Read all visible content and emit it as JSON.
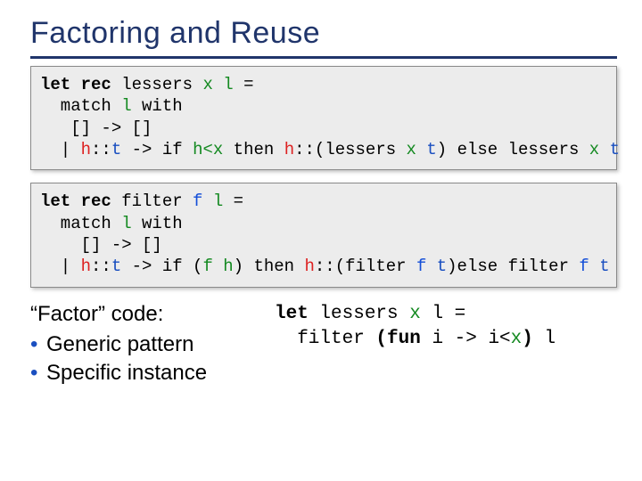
{
  "title": "Factoring and Reuse",
  "code1": {
    "l1_a": "let rec",
    "l1_b": " lessers ",
    "l1_x": "x",
    "l1_sp": " ",
    "l1_l": "l",
    "l1_eq": " =",
    "l2_a": "  match ",
    "l2_l": "l",
    "l2_b": " with",
    "l3": "   [] -> []",
    "l4_a": "  | ",
    "l4_h": "h",
    "l4_sep": "::",
    "l4_t": "t",
    "l4_b": " -> if ",
    "l4_cond": "h<x",
    "l4_c": " then ",
    "l4_h2": "h",
    "l4_sep2": "::",
    "l4_d": "(lessers ",
    "l4_x": "x",
    "l4_sp2": " ",
    "l4_t2": "t",
    "l4_e": ") else lessers ",
    "l4_x2": "x",
    "l4_sp3": " ",
    "l4_t3": "t"
  },
  "code2": {
    "l1_a": "let rec",
    "l1_b": " filter ",
    "l1_f": "f",
    "l1_sp": " ",
    "l1_l": "l",
    "l1_eq": " =",
    "l2_a": "  match ",
    "l2_l": "l",
    "l2_b": " with",
    "l3": "    [] -> []",
    "l4_a": "  | ",
    "l4_h": "h",
    "l4_sep": "::",
    "l4_t": "t",
    "l4_b": " -> if (",
    "l4_cond": "f h",
    "l4_c": ") then ",
    "l4_h2": "h",
    "l4_sep2": "::",
    "l4_d": "(filter ",
    "l4_f": "f",
    "l4_sp2": " ",
    "l4_t2": "t",
    "l4_e": ")else filter ",
    "l4_f2": "f",
    "l4_sp3": " ",
    "l4_t3": "t"
  },
  "factor": {
    "heading": "“Factor” code:",
    "b1": "Generic pattern",
    "b2": "Specific instance"
  },
  "snippet": {
    "l1_a": "let ",
    "l1_b": "lessers ",
    "l1_x": "x",
    "l1_c": " l =",
    "l2_a": "  filter ",
    "l2_b": "(fun",
    "l2_c": " i -> i<",
    "l2_x": "x",
    "l2_d": ")",
    "l2_e": " l"
  }
}
